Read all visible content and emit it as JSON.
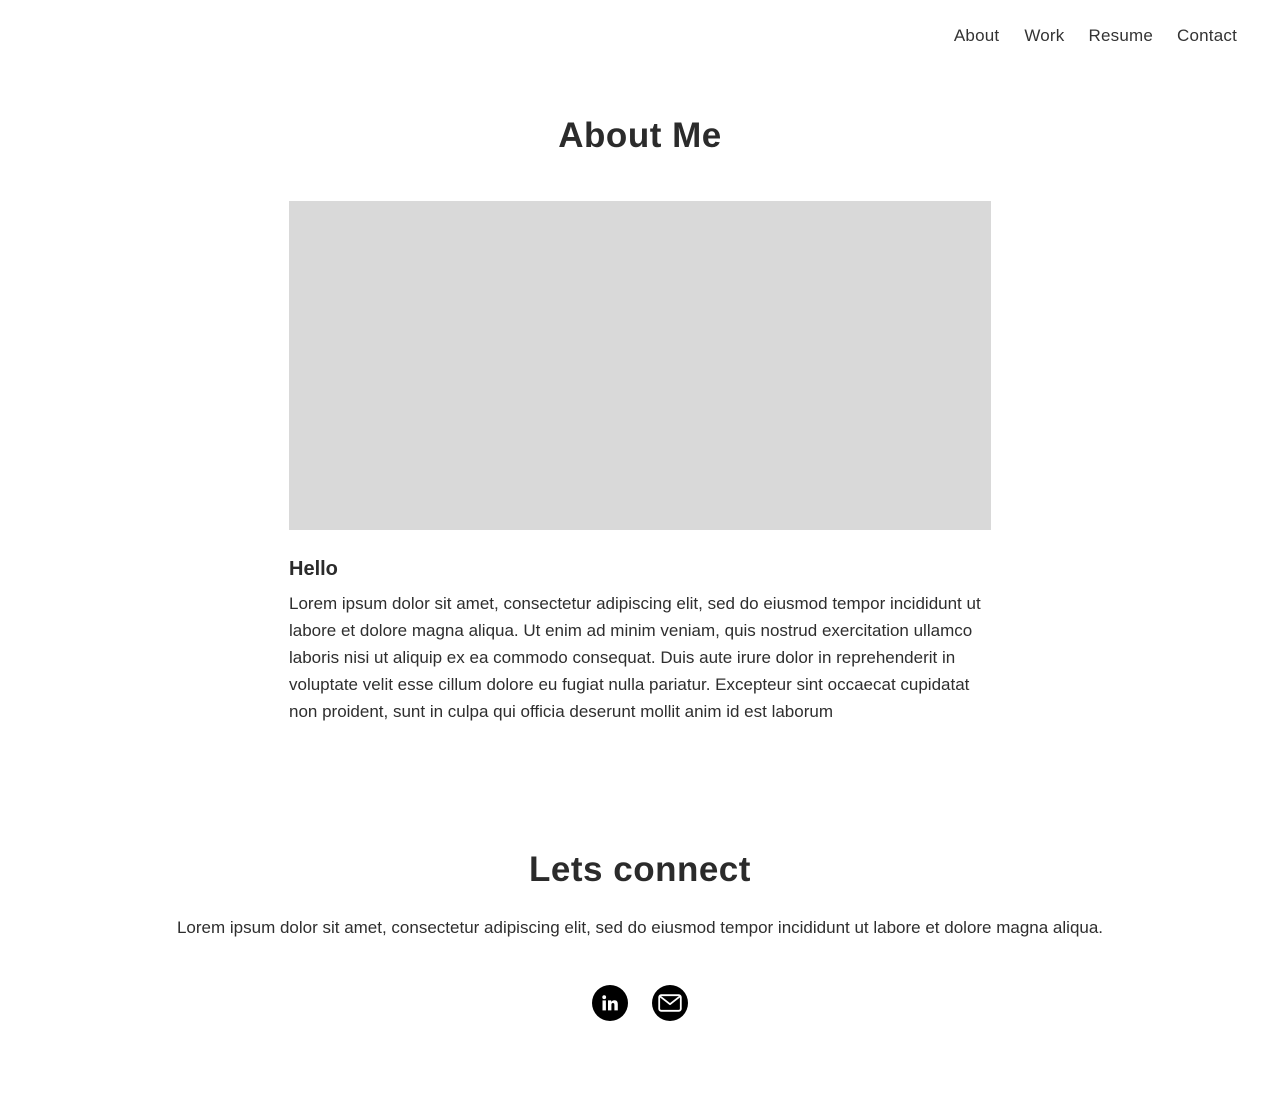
{
  "nav": {
    "items": [
      {
        "label": "About"
      },
      {
        "label": "Work"
      },
      {
        "label": "Resume"
      },
      {
        "label": "Contact"
      }
    ]
  },
  "about": {
    "title": "About Me",
    "image_placeholder_color": "#d9d9d9",
    "heading": "Hello",
    "body": "Lorem ipsum dolor sit amet, consectetur adipiscing elit, sed do eiusmod tempor incididunt ut labore et dolore magna aliqua. Ut enim ad minim veniam, quis nostrud exercitation ullamco laboris nisi ut aliquip ex ea commodo consequat. Duis aute irure dolor in reprehenderit in voluptate velit esse cillum dolore eu fugiat nulla pariatur. Excepteur sint occaecat cupidatat non proident, sunt in culpa qui officia deserunt mollit anim id est laborum"
  },
  "connect": {
    "title": "Lets connect",
    "text": "Lorem ipsum dolor sit amet, consectetur adipiscing elit, sed do eiusmod tempor incididunt ut labore et dolore magna aliqua.",
    "socials": [
      {
        "icon": "linkedin-icon"
      },
      {
        "icon": "mail-icon"
      }
    ]
  },
  "colors": {
    "text": "#2b2b2b",
    "icon_bg": "#000000",
    "icon_fg": "#ffffff",
    "background": "#ffffff"
  }
}
